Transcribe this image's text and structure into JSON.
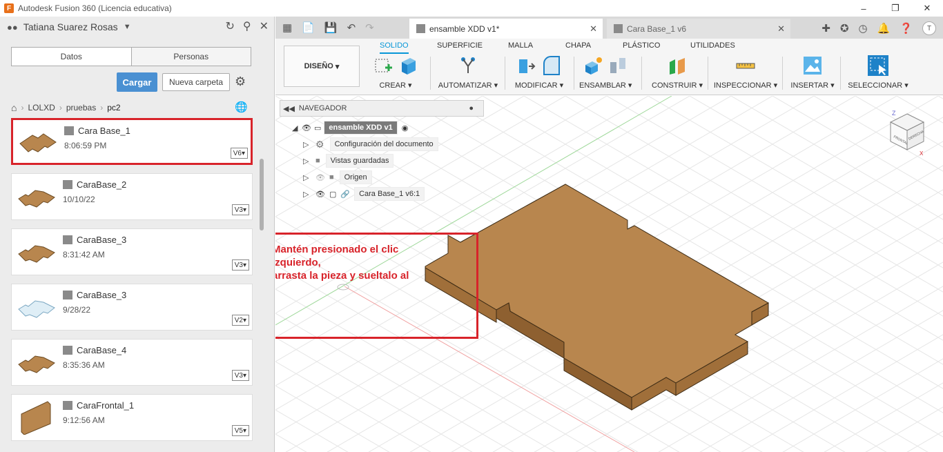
{
  "window": {
    "title": "Autodesk Fusion 360 (Licencia educativa)",
    "logo": "F"
  },
  "datapanel": {
    "user": "Tatiana Suarez Rosas",
    "tabs": [
      "Datos",
      "Personas"
    ],
    "upload_label": "Cargar",
    "new_folder_label": "Nueva carpeta",
    "breadcrumb": [
      "LOLXD",
      "pruebas",
      "pc2"
    ],
    "files": [
      {
        "name": "Cara Base_1",
        "time": "8:06:59 PM",
        "version": "V6"
      },
      {
        "name": "CaraBase_2",
        "time": "10/10/22",
        "version": "V3"
      },
      {
        "name": "CaraBase_3",
        "time": "8:31:42 AM",
        "version": "V3"
      },
      {
        "name": "CaraBase_3",
        "time": "9/28/22",
        "version": "V2"
      },
      {
        "name": "CaraBase_4",
        "time": "8:35:36 AM",
        "version": "V3"
      },
      {
        "name": "CaraFrontal_1",
        "time": "9:12:56 AM",
        "version": "V5"
      }
    ]
  },
  "tabs": {
    "active": "ensamble XDD v1*",
    "inactive": "Cara Base_1 v6",
    "avatar": "T"
  },
  "toolbar": {
    "workspace": "DISEÑO",
    "ws_tabs": [
      "SOLIDO",
      "SUPERFICIE",
      "MALLA",
      "CHAPA",
      "PLÁSTICO",
      "UTILIDADES"
    ],
    "groups": [
      "CREAR",
      "AUTOMATIZAR",
      "MODIFICAR",
      "ENSAMBLAR",
      "CONSTRUIR",
      "INSPECCIONAR",
      "INSERTAR",
      "SELECCIONAR"
    ]
  },
  "browser": {
    "title": "NAVEGADOR",
    "root": "ensamble XDD v1",
    "items": [
      "Configuración del documento",
      "Vistas guardadas",
      "Origen",
      "Cara Base_1 v6:1"
    ]
  },
  "annotation": {
    "line1": "Mantén presionado el clic",
    "line2": "izquierdo,",
    "line3": "arrasta la pieza y sueltalo al"
  },
  "viewcube": {
    "top": "Z",
    "front": "FRONTAL",
    "right": "DERECHA",
    "x": "X"
  },
  "colors": {
    "accent": "#0696d7",
    "highlight": "#d8232a",
    "wood": "#b8864e"
  }
}
